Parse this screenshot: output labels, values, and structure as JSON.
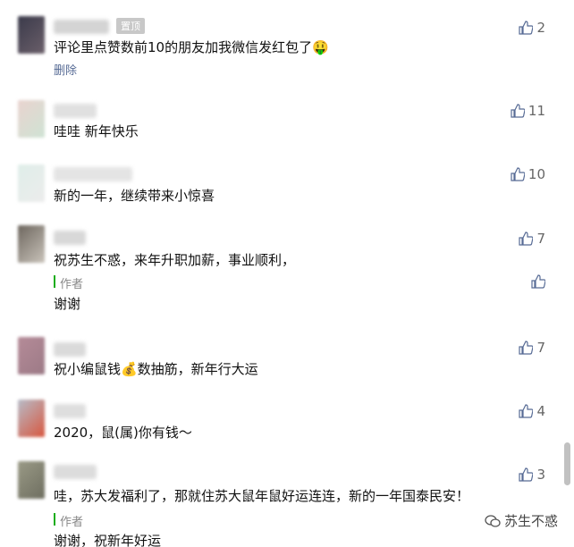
{
  "comments": [
    {
      "text": "评论里点赞数前10的朋友加我微信发红包了🤑",
      "likes": "2",
      "pinned_label": "置顶",
      "delete_label": "删除"
    },
    {
      "text": "哇哇 新年快乐",
      "likes": "11"
    },
    {
      "text": "新的一年，继续带来小惊喜",
      "likes": "10"
    },
    {
      "text": "祝苏生不惑，来年升职加薪，事业顺利，",
      "likes": "7",
      "reply_author": "作者",
      "reply_text": "谢谢"
    },
    {
      "text": "祝小编鼠钱💰数抽筋，新年行大运",
      "likes": "7"
    },
    {
      "text": "2020，鼠(属)你有钱～",
      "likes": "4"
    },
    {
      "text": "哇，苏大发福利了，那就住苏大鼠年鼠好运连连，新的一年国泰民安！",
      "likes": "3",
      "reply_author": "作者",
      "reply_text": "谢谢，祝新年好运"
    }
  ],
  "watermark": "苏生不惑",
  "colors": {
    "link": "#576b95",
    "author_bar": "#1aad19",
    "like_gray": "#666666"
  }
}
